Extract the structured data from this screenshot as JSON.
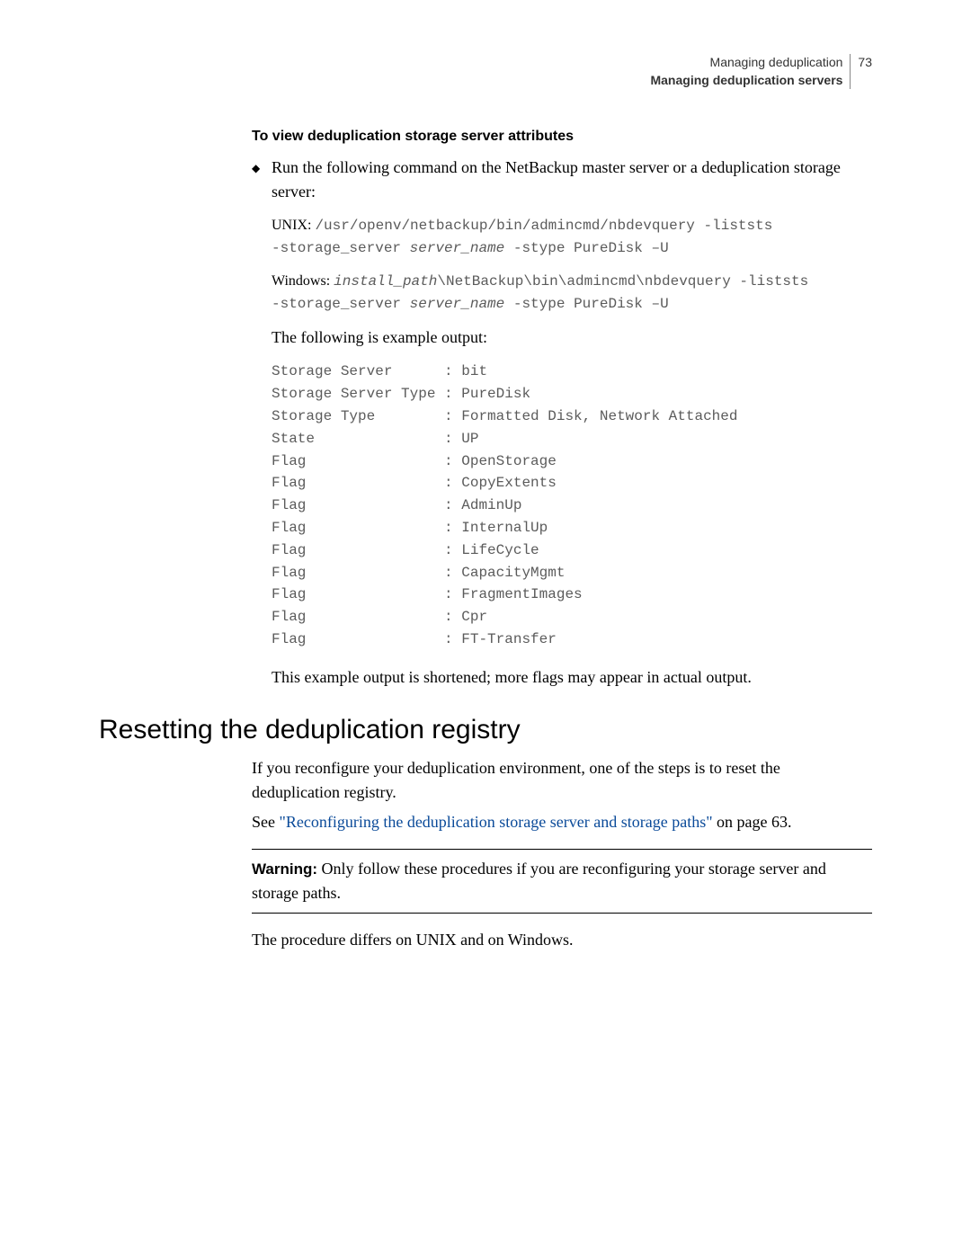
{
  "running_head": {
    "line1": "Managing deduplication",
    "line2": "Managing deduplication servers",
    "page_number": "73"
  },
  "section_title": "To view deduplication storage server attributes",
  "bullet_text": "Run the following command on the NetBackup master server or a deduplication storage server:",
  "unix": {
    "label": "UNIX: ",
    "line1_a": "/usr/openv/netbackup/bin/admincmd/nbdevquery -liststs",
    "line2_a": "-storage_server ",
    "line2_i": "server_name",
    "line2_b": " -stype PureDisk –U"
  },
  "windows": {
    "label": "Windows: ",
    "line1_i": "install_path",
    "line1_b": "\\NetBackup\\bin\\admincmd\\nbdevquery -liststs",
    "line2_a": "-storage_server ",
    "line2_i": "server_name",
    "line2_b": " -stype PureDisk –U"
  },
  "example_intro": "The following is example output:",
  "output_rows": [
    [
      "Storage Server",
      "bit"
    ],
    [
      "Storage Server Type",
      "PureDisk"
    ],
    [
      "Storage Type",
      "Formatted Disk, Network Attached"
    ],
    [
      "State",
      "UP"
    ],
    [
      "Flag",
      "OpenStorage"
    ],
    [
      "Flag",
      "CopyExtents"
    ],
    [
      "Flag",
      "AdminUp"
    ],
    [
      "Flag",
      "InternalUp"
    ],
    [
      "Flag",
      "LifeCycle"
    ],
    [
      "Flag",
      "CapacityMgmt"
    ],
    [
      "Flag",
      "FragmentImages"
    ],
    [
      "Flag",
      "Cpr"
    ],
    [
      "Flag",
      "FT-Transfer"
    ]
  ],
  "example_note": "This example output is shortened; more flags may appear in actual output.",
  "h2": "Resetting the deduplication registry",
  "p1": "If you reconfigure your deduplication environment, one of the steps is to reset the deduplication registry.",
  "see_prefix": "See ",
  "see_link": "\"Reconfiguring the deduplication storage server and storage paths\"",
  "see_suffix": " on page 63.",
  "warning_label": "Warning:",
  "warning_text": " Only follow these procedures if you are reconfiguring your storage server and storage paths.",
  "p_last": "The procedure differs on UNIX and on Windows."
}
